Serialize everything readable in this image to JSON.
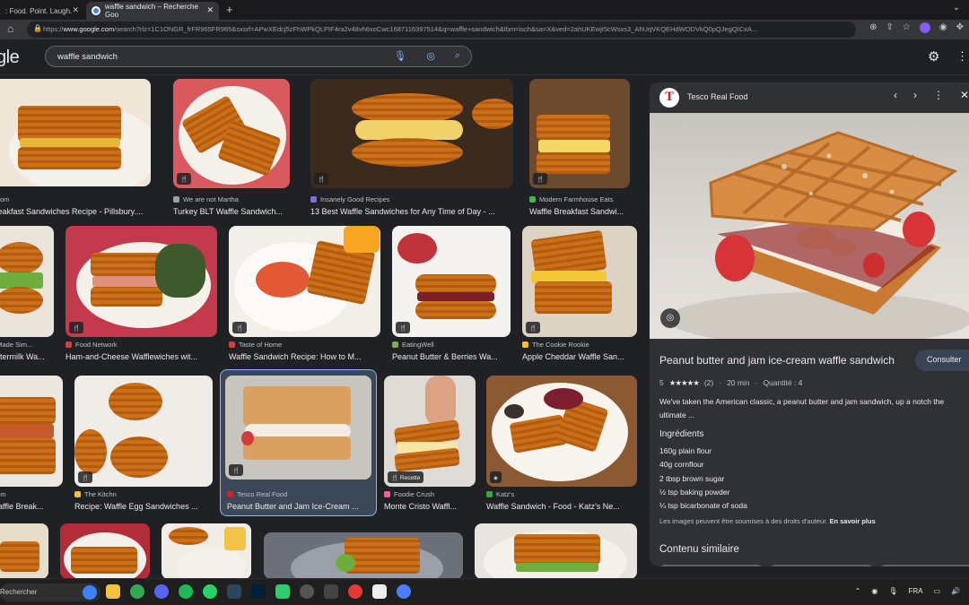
{
  "tabs": [
    {
      "label": ": Food. Point. Laugh."
    },
    {
      "label": "waffle sandwich – Recherche Goo"
    }
  ],
  "new_tab_label": "+",
  "address": {
    "prefix": "https://",
    "domain": "www.google.com",
    "rest": "/search?rlz=1C1ONGR_frFR965FR965&sxsrf=APwXEdcj5zFhWPkQLPIF4ra2v48vh6xoCwc1687116397514&q=waffle+sandwich&tbm=isch&sa=X&ved=2ahUKEwjI5cWsxs3_AhUqVKQEHdWODVkQ0pQJegQICxA..."
  },
  "logo_text": "gle",
  "search": {
    "query": "waffle sandwich"
  },
  "results": [
    {
      "source": "...com",
      "title": "...eakfast Sandwiches Recipe - Pillsbury...."
    },
    {
      "source": "We are not Martha",
      "title": "Turkey BLT Waffle Sandwich..."
    },
    {
      "source": "Insanely Good Recipes",
      "title": "13 Best Waffle Sandwiches for Any Time of Day - ..."
    },
    {
      "source": "Modern Farmhouse Eats",
      "title": "Waffle Breakfast Sandwi..."
    },
    {
      "source": "...Made Sim...",
      "title": "...ttermilk Wa..."
    },
    {
      "source": "Food Network",
      "title": "Ham-and-Cheese Wafflewiches wit..."
    },
    {
      "source": "Taste of Home",
      "title": "Waffle Sandwich Recipe: How to M..."
    },
    {
      "source": "EatingWell",
      "title": "Peanut Butter & Berries Wa..."
    },
    {
      "source": "The Cookie Rookie",
      "title": "Apple Cheddar Waffle San..."
    },
    {
      "source": "...om",
      "title": "Waffle Break..."
    },
    {
      "source": "The Kitchn",
      "title": "Recipe: Waffle Egg Sandwiches ..."
    },
    {
      "source": "Tesco Real Food",
      "title": "Peanut Butter and Jam Ice-Cream ..."
    },
    {
      "source": "Foodie Crush",
      "title": "Monte Cristo Waffl..."
    },
    {
      "source": "Katz's",
      "title": "Waffle Sandwich - Food - Katz's Ne..."
    }
  ],
  "badges": {
    "recipe": "Recette",
    "recipe_icon": "🍴"
  },
  "panel": {
    "source": "Tesco Real Food",
    "logo_letter": "T",
    "title": "Peanut butter and jam ice-cream waffle sandwich",
    "button": "Consulter",
    "rating": "5",
    "stars": "★★★★★",
    "reviews": "(2)",
    "time": "20 min",
    "quantity": "Quantité : 4",
    "description": "We've taken the American classic, a peanut butter and jam sandwich, up a notch the ultimate ...",
    "ingredients_title": "Ingrédients",
    "ingredients": [
      "160g plain flour",
      "40g cornflour",
      "2 tbsp brown sugar",
      "½ tsp baking powder",
      "¼ tsp bicarbonate of soda"
    ],
    "rights_text": "Les images peuvent être soumises à des droits d'auteur.",
    "rights_link": "En savoir plus",
    "similar_title": "Contenu similaire"
  },
  "taskbar": {
    "search": "Rechercher",
    "lang": "FRA"
  },
  "colors": {
    "background": "#202124",
    "panel": "#303134",
    "accent": "#8ab4f8",
    "tesco_red": "#e11b22"
  }
}
